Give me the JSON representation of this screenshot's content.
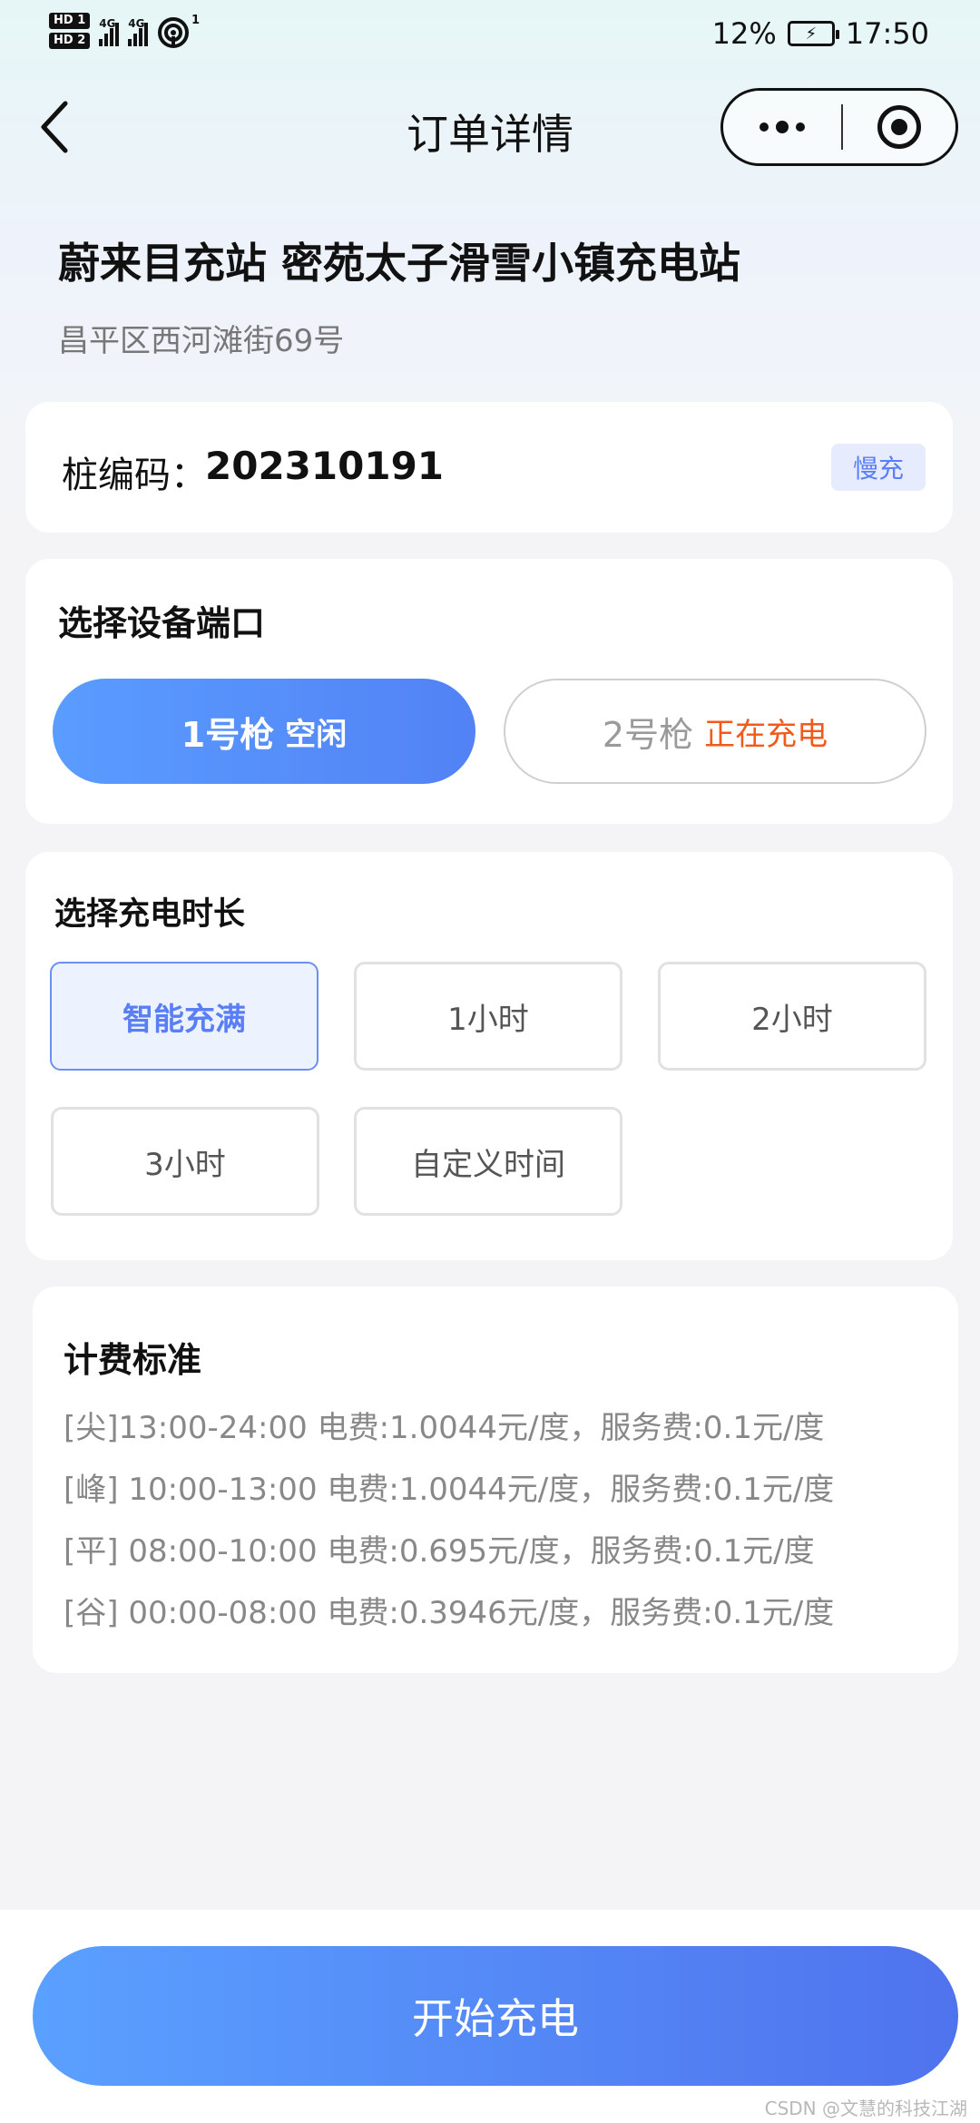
{
  "status_bar": {
    "hd1": "HD 1",
    "hd2": "HD 2",
    "net1": "4G",
    "net2": "4G",
    "hotspot_count": "1",
    "battery_percent": "12%",
    "time": "17:50"
  },
  "nav": {
    "title": "订单详情"
  },
  "station": {
    "name": "蔚来目充站 密苑太子滑雪小镇充电站",
    "address": "昌平区西河滩街69号"
  },
  "pile": {
    "label": "桩编码：",
    "code": "202310191",
    "type_tag": "慢充"
  },
  "ports": {
    "title": "选择设备端口",
    "items": [
      {
        "name": "1号枪",
        "status": "空闲"
      },
      {
        "name": "2号枪",
        "status": "正在充电"
      }
    ]
  },
  "duration": {
    "title": "选择充电时长",
    "options": [
      "智能充满",
      "1小时",
      "2小时",
      "3小时",
      "自定义时间"
    ],
    "selected": "智能充满"
  },
  "fees": {
    "title": "计费标准",
    "lines": [
      "[尖]13:00-24:00 电费:1.0044元/度，服务费:0.1元/度",
      "[峰] 10:00-13:00 电费:1.0044元/度，服务费:0.1元/度",
      "[平] 08:00-10:00 电费:0.695元/度，服务费:0.1元/度",
      "[谷] 00:00-08:00 电费:0.3946元/度，服务费:0.1元/度"
    ]
  },
  "actions": {
    "start_label": "开始充电"
  },
  "watermark": "CSDN @文慧的科技江湖",
  "colors": {
    "accent": "#5a86f5",
    "charging_status": "#f05a1a",
    "tag_bg": "#e6ecfd"
  }
}
